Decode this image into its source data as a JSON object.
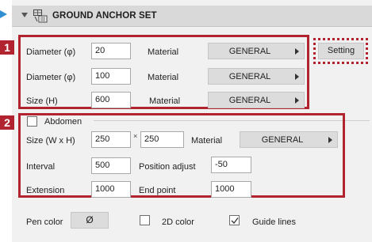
{
  "header": {
    "title": "GROUND ANCHOR SET"
  },
  "callouts": {
    "one": "1",
    "two": "2"
  },
  "section1": {
    "rows": [
      {
        "label": "Diameter (φ)",
        "value": "20",
        "material_label": "Material",
        "material_value": "GENERAL"
      },
      {
        "label": "Diameter (φ)",
        "value": "100",
        "material_label": "Material",
        "material_value": "GENERAL"
      },
      {
        "label": "Size (H)",
        "value": "600",
        "material_label": "Material",
        "material_value": "GENERAL"
      }
    ],
    "setting_button": "Setting"
  },
  "section2": {
    "abdomen_label": "Abdomen",
    "abdomen_checked": false,
    "size_label": "Size (W x H)",
    "size_w": "250",
    "size_sep": "×",
    "size_h": "250",
    "material_label": "Material",
    "material_value": "GENERAL",
    "interval_label": "Interval",
    "interval_value": "500",
    "position_adjust_label": "Position adjust",
    "position_adjust_value": "-50",
    "extension_label": "Extension",
    "extension_value": "1000",
    "end_point_label": "End point",
    "end_point_value": "1000"
  },
  "footer": {
    "pen_color_label": "Pen color",
    "pen_color_value": "Ø",
    "color2d_label": "2D color",
    "color2d_checked": false,
    "guide_lines_label": "Guide lines",
    "guide_lines_checked": true
  },
  "colors": {
    "accent_red": "#b22330",
    "arrow_blue": "#2f8fd0"
  }
}
